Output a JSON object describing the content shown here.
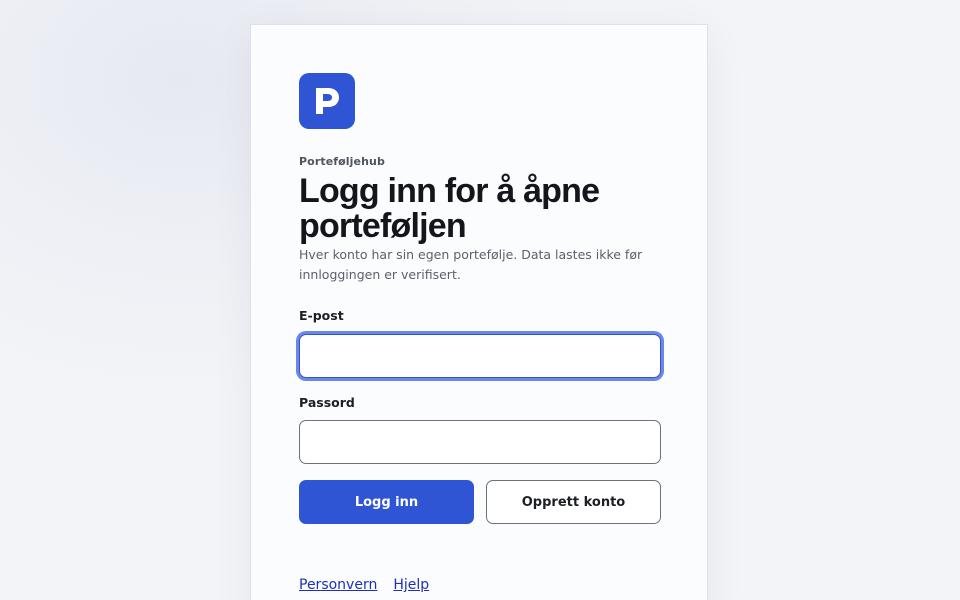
{
  "brand": {
    "logo_letter": "P",
    "logo_icon": "p-letter-logo-icon",
    "name": "Porteføljehub",
    "accent_color": "#2f55d4"
  },
  "login": {
    "title": "Logg inn for å åpne porteføljen",
    "subtitle": "Hver konto har sin egen portefølje. Data lastes ikke før innloggingen er verifisert.",
    "email_label": "E-post",
    "email_value": "",
    "password_label": "Passord",
    "password_value": "",
    "submit_label": "Logg inn",
    "create_account_label": "Opprett konto"
  },
  "footer": {
    "links": [
      "Personvern",
      "Hjelp"
    ]
  }
}
